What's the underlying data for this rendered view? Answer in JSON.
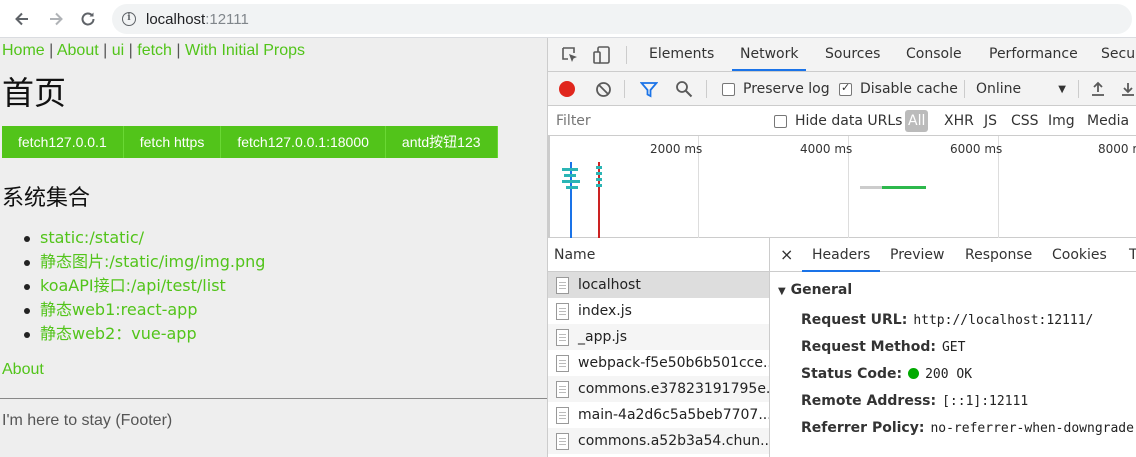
{
  "browser": {
    "host": "localhost",
    "port": ":12111"
  },
  "page": {
    "nav": [
      "Home",
      "About",
      "ui",
      "fetch",
      "With Initial Props"
    ],
    "nav_separator": "|",
    "title": "首页",
    "buttons": [
      "fetch127.0.0.1",
      "fetch https",
      "fetch127.0.0.1:18000",
      "antd按钮123"
    ],
    "section_title": "系统集合",
    "links": [
      "static:/static/",
      "静态图片:/static/img/img.png",
      "koaAPI接口:/api/test/list",
      "静态web1:react-app",
      "静态web2：vue-app"
    ],
    "about_link": "About",
    "footer": "I'm here to stay (Footer)"
  },
  "devtools": {
    "tabs": [
      "Elements",
      "Network",
      "Sources",
      "Console",
      "Performance",
      "Secur"
    ],
    "active_tab": "Network",
    "toolbar": {
      "preserve_log": "Preserve log",
      "disable_cache": "Disable cache",
      "throttle": "Online"
    },
    "filter": {
      "placeholder": "Filter",
      "hide_data_urls": "Hide data URLs",
      "types": [
        "All",
        "XHR",
        "JS",
        "CSS",
        "Img",
        "Media"
      ]
    },
    "timeline": {
      "ticks": [
        "2000 ms",
        "4000 ms",
        "6000 ms",
        "8000 m"
      ]
    },
    "requests": {
      "header": "Name",
      "items": [
        "localhost",
        "index.js",
        "_app.js",
        "webpack-f5e50b6b501cce...",
        "commons.e37823191795e...",
        "main-4a2d6c5a5beb7707...",
        "commons.a52b3a54.chun..."
      ]
    },
    "details": {
      "close": "×",
      "tabs": [
        "Headers",
        "Preview",
        "Response",
        "Cookies",
        "T"
      ],
      "general_title": "General",
      "fields": [
        {
          "key": "Request URL:",
          "value": "http://localhost:12111/"
        },
        {
          "key": "Request Method:",
          "value": "GET"
        },
        {
          "key": "Status Code:",
          "value": "200 OK"
        },
        {
          "key": "Remote Address:",
          "value": "[::1]:12111"
        },
        {
          "key": "Referrer Policy:",
          "value": "no-referrer-when-downgrade"
        }
      ]
    }
  },
  "colors": {
    "accent_green": "#52c41a",
    "record_red": "#e0261d",
    "devtools_blue": "#1a73e8",
    "status_ok": "#00aa00"
  }
}
